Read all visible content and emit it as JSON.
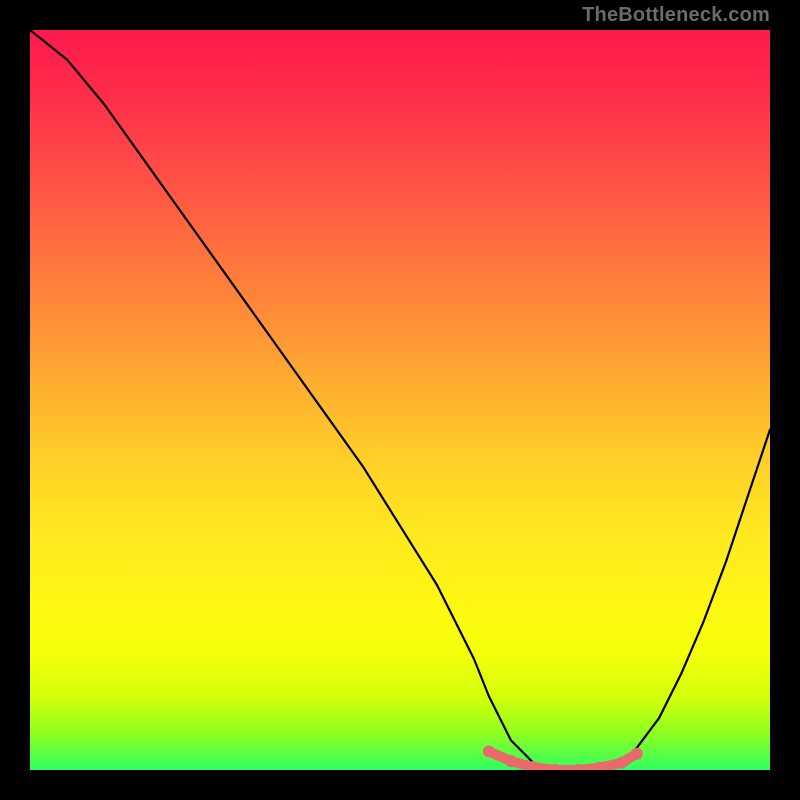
{
  "attribution": "TheBottleneck.com",
  "chart_data": {
    "type": "line",
    "title": "",
    "xlabel": "",
    "ylabel": "",
    "xlim": [
      0,
      100
    ],
    "ylim": [
      0,
      100
    ],
    "background_gradient": {
      "top": "#ff1a4d",
      "mid_upper": "#ff8b38",
      "mid_lower": "#fff812",
      "bottom": "#2fff60"
    },
    "series": [
      {
        "name": "bottleneck-curve",
        "color": "#000000",
        "x": [
          0,
          5,
          10,
          15,
          20,
          25,
          30,
          35,
          40,
          45,
          50,
          55,
          60,
          62,
          65,
          68,
          71,
          74,
          77,
          80,
          82,
          85,
          88,
          91,
          94,
          97,
          100
        ],
        "y": [
          100,
          96,
          90,
          83,
          76,
          69,
          62,
          55,
          48,
          41,
          33,
          25,
          15,
          10,
          4,
          1,
          0,
          0,
          0,
          1,
          3,
          7,
          13,
          20,
          28,
          37,
          46
        ]
      },
      {
        "name": "optimal-band-marker",
        "color": "#e86a6a",
        "x": [
          62,
          65,
          68,
          71,
          74,
          77,
          80,
          82
        ],
        "y": [
          2.5,
          1.2,
          0.4,
          0,
          0,
          0.3,
          1.0,
          2.2
        ]
      }
    ]
  }
}
